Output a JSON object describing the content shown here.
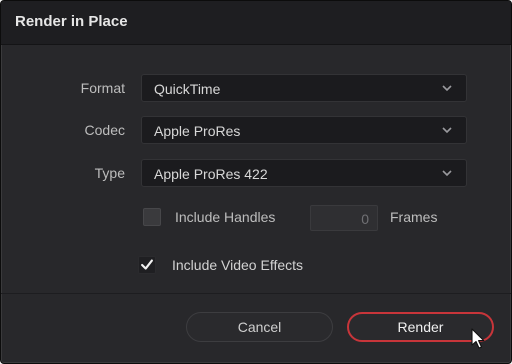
{
  "dialog": {
    "title": "Render in Place"
  },
  "fields": [
    {
      "label": "Format",
      "value": "QuickTime"
    },
    {
      "label": "Codec",
      "value": "Apple ProRes"
    },
    {
      "label": "Type",
      "value": "Apple ProRes 422"
    }
  ],
  "options": {
    "include_handles": {
      "label": "Include Handles",
      "checked": false,
      "frames_value": "0",
      "frames_label": "Frames"
    },
    "include_video_effects": {
      "label": "Include Video Effects",
      "checked": true
    }
  },
  "buttons": {
    "cancel": "Cancel",
    "render": "Render"
  },
  "colors": {
    "dialog_bg": "#28282b",
    "titlebar_bg": "#1e1e21",
    "field_bg": "#1b1b1e",
    "accent_focus": "#c8353a"
  },
  "icons": {
    "select_chevron": "chevron-down-icon",
    "checkmark": "checkmark-icon",
    "pointer": "mouse-pointer-icon"
  }
}
